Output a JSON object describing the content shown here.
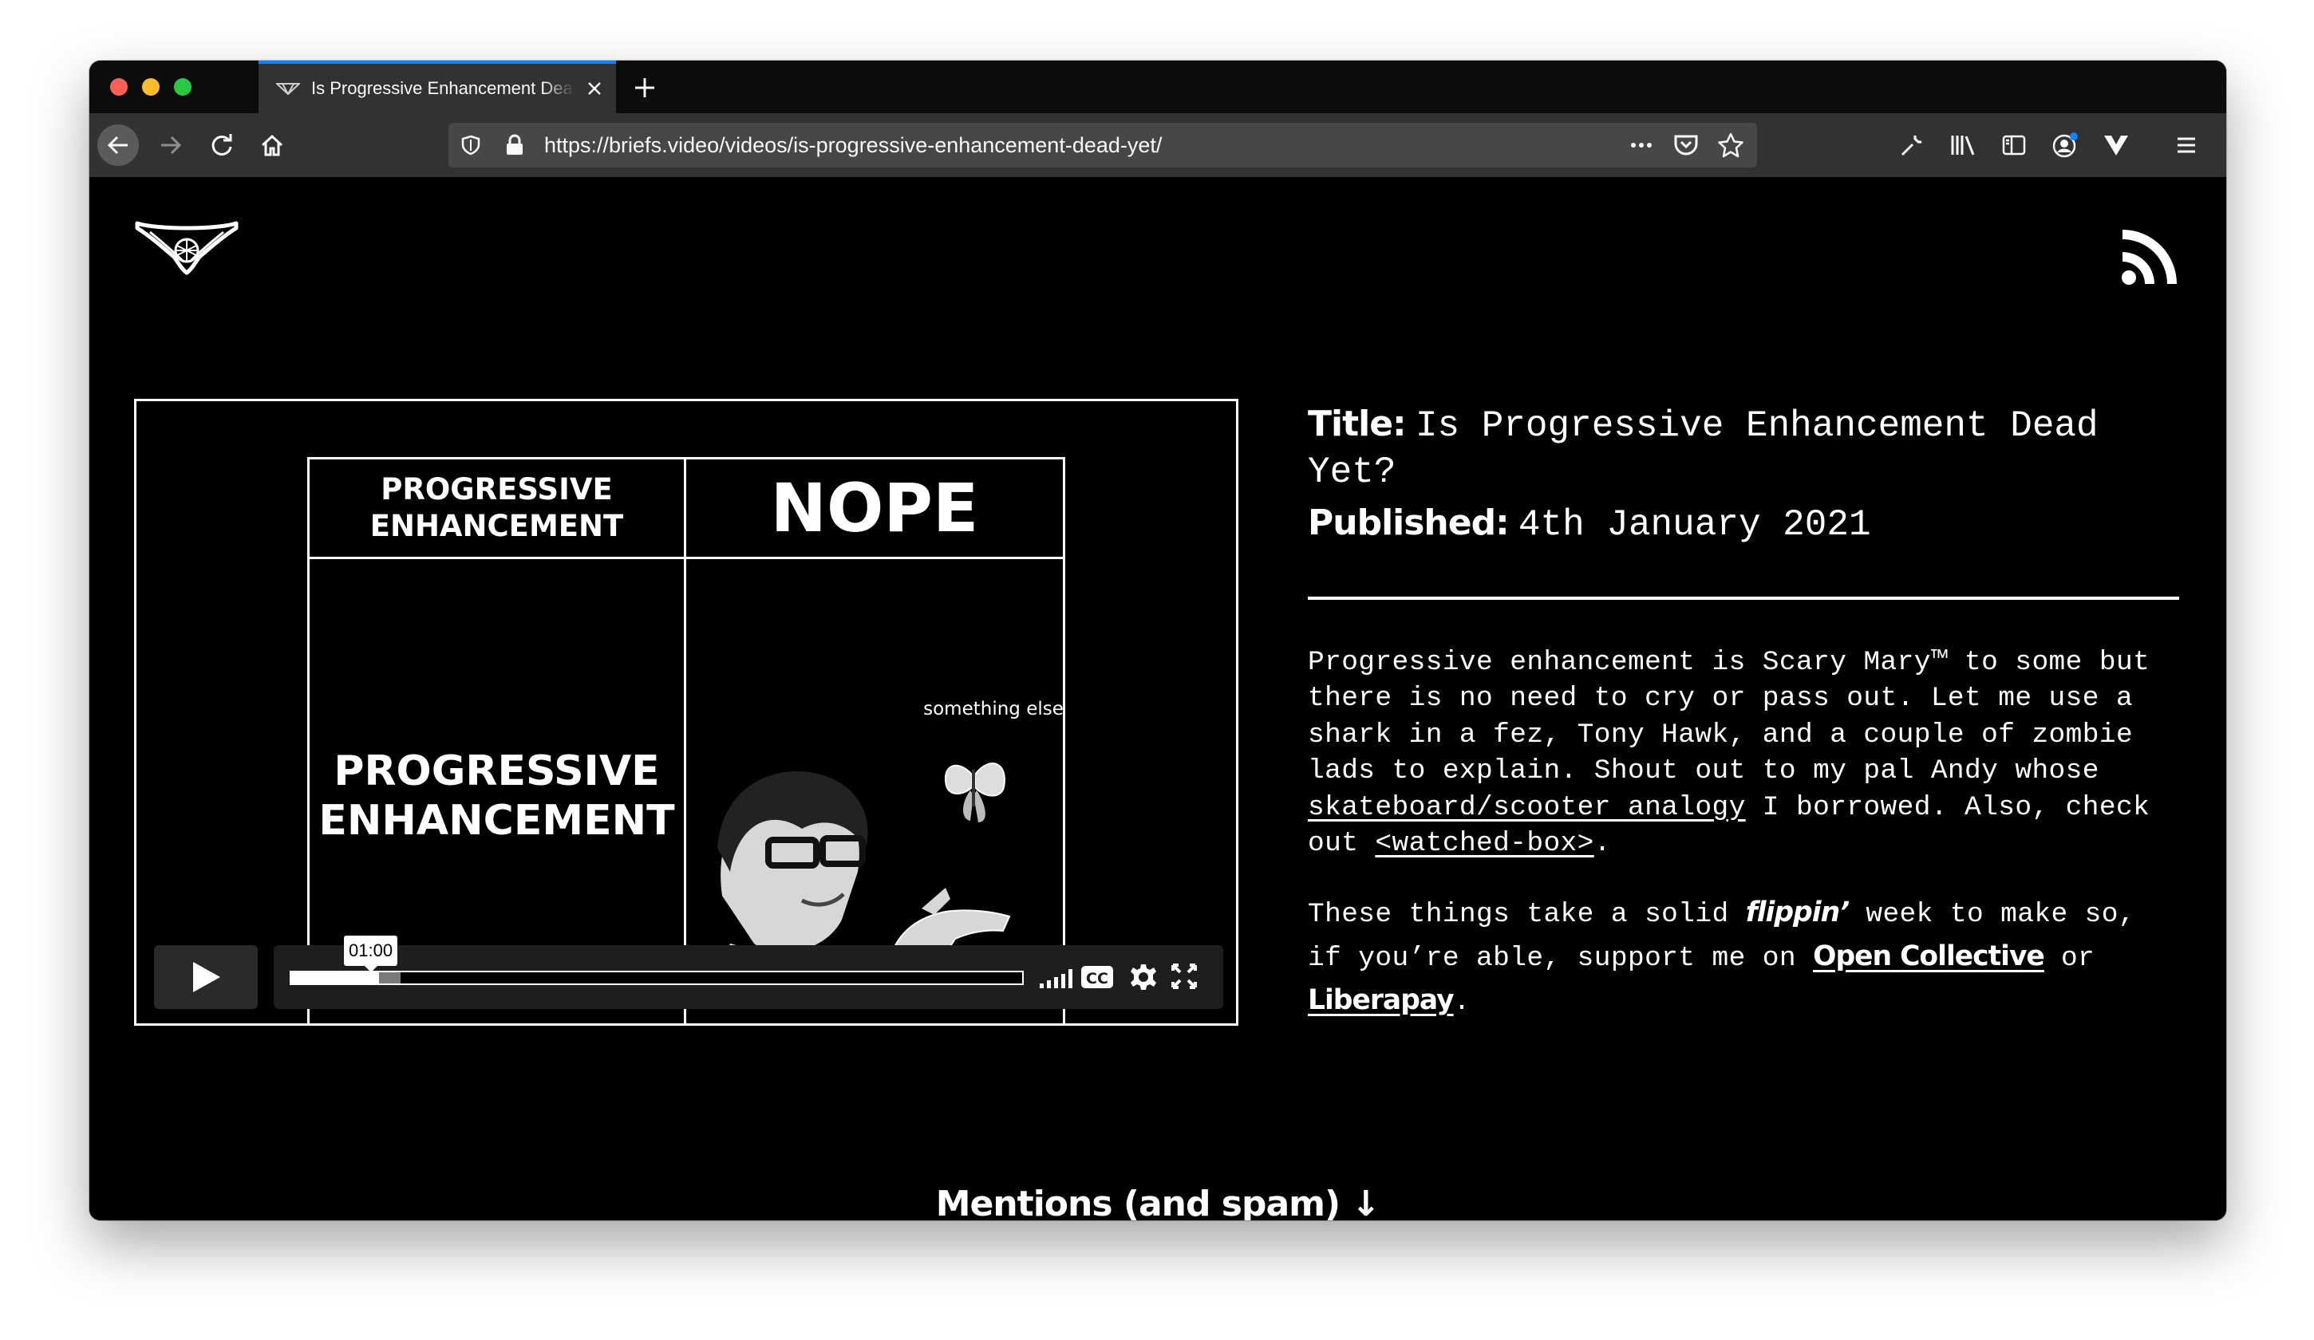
{
  "browser": {
    "tab_title": "Is Progressive Enhancement Dead Yet? – Front-End Briefs",
    "url": "https://briefs.video/videos/is-progressive-enhancement-dead-yet/"
  },
  "video": {
    "meme_top_left": "PROGRESSIVE ENHANCEMENT",
    "meme_top_right": "NOPE",
    "meme_bottom_left": "PROGRESSIVE ENHANCEMENT",
    "meme_bottom_right": "something else",
    "time_tooltip": "01:00",
    "played_fraction": 0.12,
    "buffered_fraction": 0.15
  },
  "meta": {
    "title_label": "Title:",
    "title_value": "Is Progressive Enhancement Dead Yet?",
    "published_label": "Published:",
    "published_value": "4th January 2021"
  },
  "description": {
    "p1_text": "Progressive enhancement is Scary Mary™ to some but there is no need to cry or pass out. Let me use a shark in a fez, Tony Hawk, and a couple of zombie lads to explain. Shout out to my pal Andy whose ",
    "p1_link1": "skateboard/scooter analogy",
    "p1_mid": " I borrowed. Also, check out ",
    "p1_link2": "<watched-box>",
    "p1_end": ".",
    "p2_start": "These things take a solid ",
    "p2_emph": "flippin’",
    "p2_mid": " week to make so, if you’re able, support me on ",
    "p2_link1": "Open Collective",
    "p2_or": " or ",
    "p2_link2": "Liberapay",
    "p2_end": "."
  },
  "mentions": "Mentions (and spam) ↓",
  "colors": {
    "background": "#000000",
    "text": "#ffffff",
    "tab_accent": "#0a84ff",
    "toolbar": "#323234"
  }
}
